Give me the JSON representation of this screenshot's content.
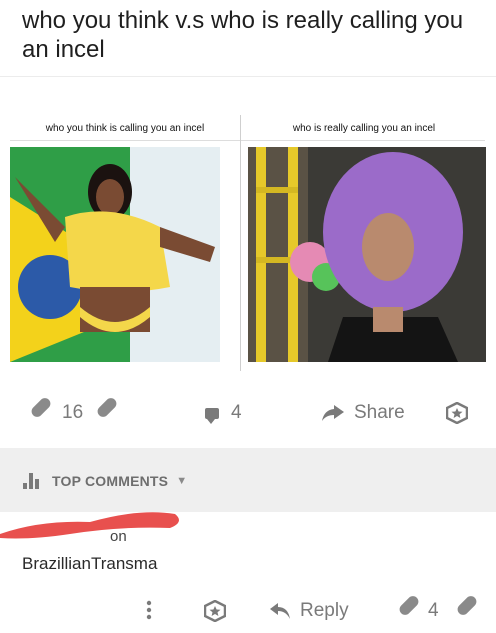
{
  "post": {
    "title": "who you think v.s who is really calling you an incel"
  },
  "meme": {
    "left_caption": "who you think is calling you an incel",
    "right_caption": "who is really calling you an incel"
  },
  "actions": {
    "upvotes": "16",
    "comments": "4",
    "share_label": "Share"
  },
  "section": {
    "top_comments_label": "TOP COMMENTS"
  },
  "comment": {
    "author_partial": "on",
    "text": "BrazillianTransma",
    "reply_label": "Reply",
    "votes": "4"
  },
  "colors": {
    "redaction": "#e8504e",
    "icon_gray": "#7a7a7a",
    "section_bg": "#efefef"
  }
}
